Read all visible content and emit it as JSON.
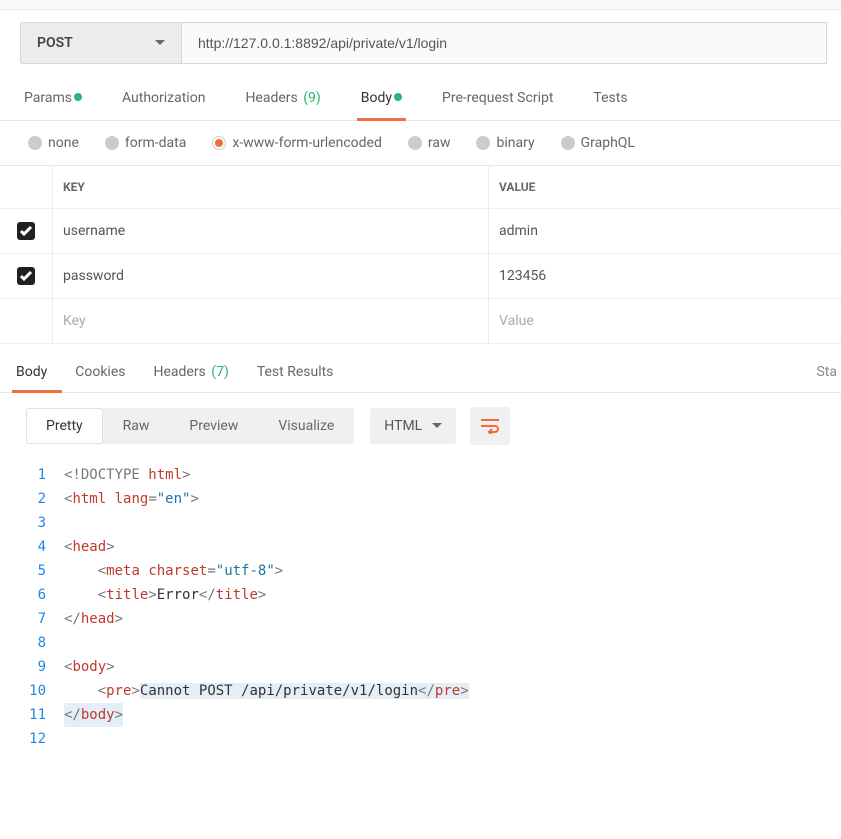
{
  "method": "POST",
  "url": "http://127.0.0.1:8892/api/private/v1/login",
  "request_tabs": {
    "params": "Params",
    "authorization": "Authorization",
    "headers": "Headers",
    "headers_count": "(9)",
    "body": "Body",
    "prerequest": "Pre-request Script",
    "tests": "Tests"
  },
  "body_types": {
    "none": "none",
    "formdata": "form-data",
    "urlencoded": "x-www-form-urlencoded",
    "raw": "raw",
    "binary": "binary",
    "graphql": "GraphQL"
  },
  "kv": {
    "key_header": "KEY",
    "value_header": "VALUE",
    "rows": [
      {
        "key": "username",
        "value": "admin"
      },
      {
        "key": "password",
        "value": "123456"
      }
    ],
    "key_placeholder": "Key",
    "value_placeholder": "Value"
  },
  "response_tabs": {
    "body": "Body",
    "cookies": "Cookies",
    "headers": "Headers",
    "headers_count": "(7)",
    "testresults": "Test Results",
    "status": "Sta"
  },
  "viewer": {
    "pretty": "Pretty",
    "raw": "Raw",
    "preview": "Preview",
    "visualize": "Visualize",
    "format": "HTML"
  },
  "code": {
    "l1a": "<!",
    "l1b": "DOCTYPE ",
    "l1c": "html",
    "l1d": ">",
    "l2a": "<",
    "l2b": "html ",
    "l2c": "lang",
    "l2d": "=",
    "l2e": "\"en\"",
    "l2f": ">",
    "l4a": "<",
    "l4b": "head",
    "l4c": ">",
    "l5pad": "    ",
    "l5a": "<",
    "l5b": "meta ",
    "l5c": "charset",
    "l5d": "=",
    "l5e": "\"utf-8\"",
    "l5f": ">",
    "l6pad": "    ",
    "l6a": "<",
    "l6b": "title",
    "l6c": ">",
    "l6d": "Error",
    "l6e": "</",
    "l6f": "title",
    "l6g": ">",
    "l7a": "</",
    "l7b": "head",
    "l7c": ">",
    "l9a": "<",
    "l9b": "body",
    "l9c": ">",
    "l10pad": "    ",
    "l10a": "<",
    "l10b": "pre",
    "l10c": ">",
    "l10d": "Cannot POST /api/private/v1/login",
    "l10e": "</",
    "l10f": "pre",
    "l10g": ">",
    "l11a": "</",
    "l11b": "body",
    "l11c": ">",
    "ln1": "1",
    "ln2": "2",
    "ln3": "3",
    "ln4": "4",
    "ln5": "5",
    "ln6": "6",
    "ln7": "7",
    "ln8": "8",
    "ln9": "9",
    "ln10": "10",
    "ln11": "11",
    "ln12": "12"
  }
}
